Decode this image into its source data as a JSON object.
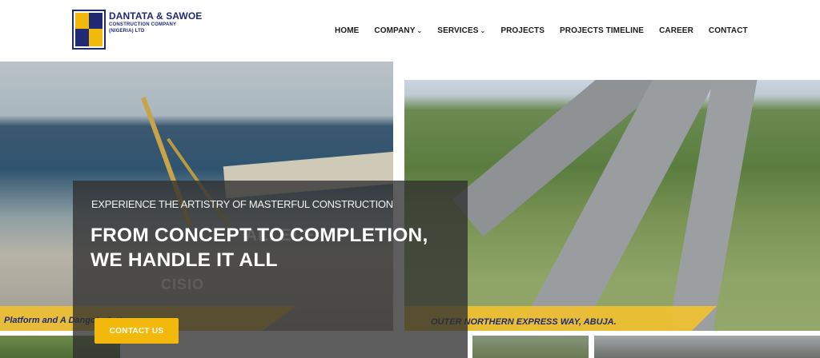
{
  "brand": {
    "name": "DANTATA & SAWOE",
    "subtitle_line1": "CONSTRUCTION COMPANY",
    "subtitle_line2": "(NIGERIA) LTD",
    "colors": {
      "navy": "#1f2a72",
      "gold": "#f2b90c"
    }
  },
  "nav": {
    "items": [
      {
        "label": "HOME",
        "has_dropdown": false
      },
      {
        "label": "COMPANY",
        "has_dropdown": true
      },
      {
        "label": "SERVICES",
        "has_dropdown": true
      },
      {
        "label": "PROJECTS",
        "has_dropdown": false
      },
      {
        "label": "PROJECTS TIMELINE",
        "has_dropdown": false
      },
      {
        "label": "CAREER",
        "has_dropdown": false
      },
      {
        "label": "CONTACT",
        "has_dropdown": false
      }
    ],
    "dropdown_icon": "chevron-down-icon"
  },
  "hero": {
    "eyebrow": "EXPERIENCE THE ARTISTRY OF MASTERFUL CONSTRUCTION",
    "headline": "FROM CONCEPT TO COMPLETION, WE HANDLE IT ALL",
    "cta_label": "CONTACT US",
    "ghost_text_1": "ALLELE",
    "ghost_text_2": "CISIO"
  },
  "gallery": {
    "left_caption": "Platform and A                    Dangote Jetty",
    "right_caption": "OUTER NORTHERN EXPRESS WAY, ABUJA."
  }
}
